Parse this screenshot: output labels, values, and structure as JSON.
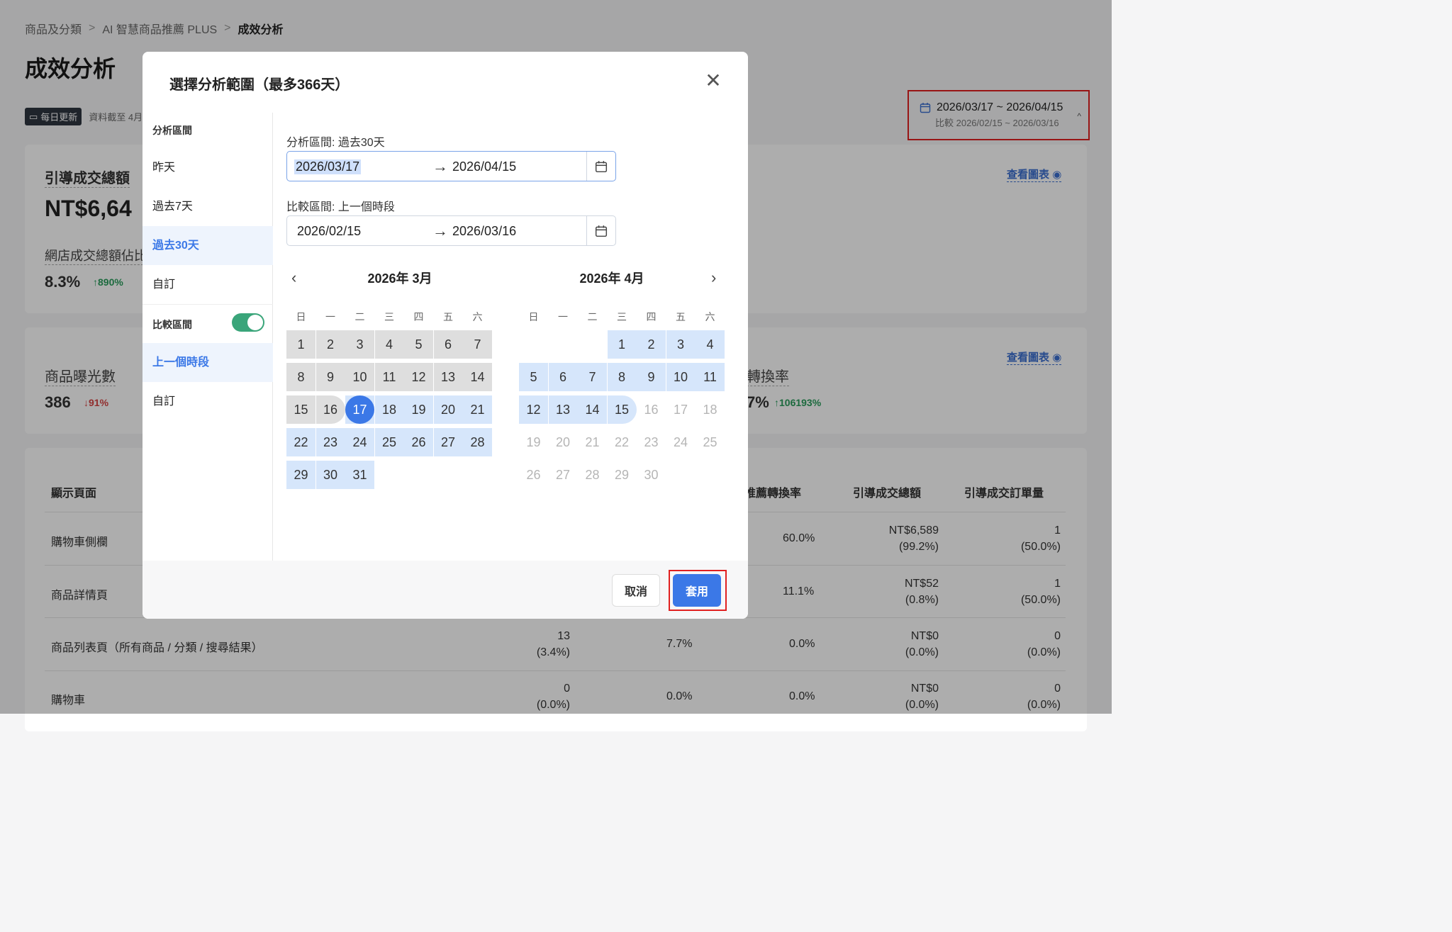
{
  "breadcrumb": [
    "商品及分類",
    "AI 智慧商品推薦 PLUS",
    "成效分析"
  ],
  "page_title": "成效分析",
  "update_badge": "每日更新",
  "data_as_of": "資料截至 4月",
  "date_range": {
    "main": "2026/03/17 ~ 2026/04/15",
    "compare": "比較 2026/02/15 ~ 2026/03/16"
  },
  "card1": {
    "title": "引導成交總額",
    "value": "NT$6,64",
    "sub_title": "網店成交總額佔比",
    "sub_value": "8.3%",
    "sub_change": "↑890%",
    "view_chart": "查看圖表"
  },
  "card2": {
    "title": "商品曝光數",
    "value": "386",
    "change": "↓91%",
    "right_title": "轉換率",
    "right_value": "7%",
    "right_change": "↑106193%",
    "view_chart": "查看圖表"
  },
  "table": {
    "headers": {
      "page": "顯示頁面",
      "rec_conv": "推薦轉換率",
      "gmv": "引導成交總額",
      "orders": "引導成交訂單量"
    },
    "rows": [
      {
        "page": "購物車側欄",
        "c1": "",
        "c1b": "",
        "c2": "",
        "c3": "60.0%",
        "gmv": "NT$6,589",
        "gmv_pct": "(99.2%)",
        "orders": "1",
        "orders_pct": "(50.0%)"
      },
      {
        "page": "商品詳情頁",
        "c1": "",
        "c1b": "",
        "c2": "",
        "c3": "11.1%",
        "gmv": "NT$52",
        "gmv_pct": "(0.8%)",
        "orders": "1",
        "orders_pct": "(50.0%)"
      },
      {
        "page": "商品列表頁（所有商品 / 分類 / 搜尋結果）",
        "c1": "13",
        "c1b": "(3.4%)",
        "c2": "7.7%",
        "c3": "0.0%",
        "gmv": "NT$0",
        "gmv_pct": "(0.0%)",
        "orders": "0",
        "orders_pct": "(0.0%)"
      },
      {
        "page": "購物車",
        "c1": "0",
        "c1b": "(0.0%)",
        "c2": "0.0%",
        "c3": "0.0%",
        "gmv": "NT$0",
        "gmv_pct": "(0.0%)",
        "orders": "0",
        "orders_pct": "(0.0%)"
      }
    ]
  },
  "modal": {
    "title": "選擇分析範圍（最多366天）",
    "sidebar": {
      "analysis_head": "分析區間",
      "options": [
        "昨天",
        "過去7天",
        "過去30天",
        "自訂"
      ],
      "active_option": "過去30天",
      "compare_head": "比較區間",
      "compare_enabled": true,
      "compare_options": [
        "上一個時段",
        "自訂"
      ],
      "active_compare": "上一個時段"
    },
    "analysis_label": "分析區間: 過去30天",
    "analysis_start": "2026/03/17",
    "analysis_end": "2026/04/15",
    "compare_label": "比較區間: 上一個時段",
    "compare_start": "2026/02/15",
    "compare_end": "2026/03/16",
    "calendars": [
      {
        "title": "2026年 3月",
        "weekdays": [
          "日",
          "一",
          "二",
          "三",
          "四",
          "五",
          "六"
        ],
        "first_weekday": 0,
        "days": 31,
        "grey_until": 16,
        "selected": 17,
        "blue_until": 31,
        "muted_from": 99
      },
      {
        "title": "2026年 4月",
        "weekdays": [
          "日",
          "一",
          "二",
          "三",
          "四",
          "五",
          "六"
        ],
        "first_weekday": 3,
        "days": 30,
        "grey_until": 0,
        "selected": 0,
        "blue_until": 15,
        "muted_from": 16
      }
    ],
    "cancel_label": "取消",
    "apply_label": "套用"
  },
  "colors": {
    "accent": "#3b78e7",
    "highlight": "#e02020",
    "compare_fill": "#dedede",
    "range_fill": "#d6e6fb",
    "toggle_on": "#3aa57a"
  }
}
